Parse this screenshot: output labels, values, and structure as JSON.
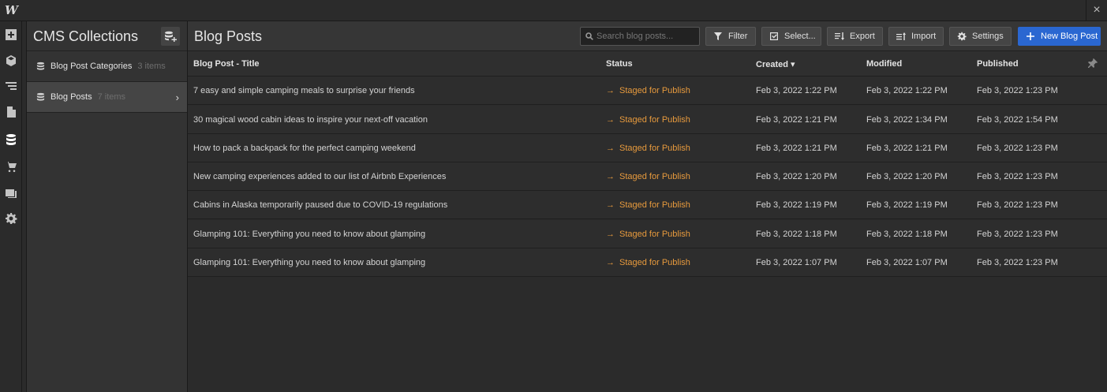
{
  "app": {
    "logo": "W",
    "close": "×"
  },
  "collections": {
    "title": "CMS Collections",
    "items": [
      {
        "name": "Blog Post Categories",
        "count": "3 items"
      },
      {
        "name": "Blog Posts",
        "count": "7 items"
      }
    ]
  },
  "main": {
    "title": "Blog Posts",
    "search_placeholder": "Search blog posts...",
    "buttons": {
      "filter": "Filter",
      "select": "Select...",
      "export": "Export",
      "import": "Import",
      "settings": "Settings",
      "new": "New Blog Post"
    }
  },
  "table": {
    "headers": {
      "title": "Blog Post - Title",
      "status": "Status",
      "created": "Created",
      "modified": "Modified",
      "published": "Published"
    },
    "sort_indicator": "▾",
    "rows": [
      {
        "title": "7 easy and simple camping meals to surprise your friends",
        "status": "Staged for Publish",
        "created": "Feb 3, 2022 1:22 PM",
        "modified": "Feb 3, 2022 1:22 PM",
        "published": "Feb 3, 2022 1:23 PM"
      },
      {
        "title": "30 magical wood cabin ideas to inspire your next-off vacation",
        "status": "Staged for Publish",
        "created": "Feb 3, 2022 1:21 PM",
        "modified": "Feb 3, 2022 1:34 PM",
        "published": "Feb 3, 2022 1:54 PM"
      },
      {
        "title": "How to pack a backpack for the perfect camping weekend",
        "status": "Staged for Publish",
        "created": "Feb 3, 2022 1:21 PM",
        "modified": "Feb 3, 2022 1:21 PM",
        "published": "Feb 3, 2022 1:23 PM"
      },
      {
        "title": "New camping experiences added to our list of Airbnb Experiences",
        "status": "Staged for Publish",
        "created": "Feb 3, 2022 1:20 PM",
        "modified": "Feb 3, 2022 1:20 PM",
        "published": "Feb 3, 2022 1:23 PM"
      },
      {
        "title": "Cabins in Alaska temporarily paused due to COVID-19 regulations",
        "status": "Staged for Publish",
        "created": "Feb 3, 2022 1:19 PM",
        "modified": "Feb 3, 2022 1:19 PM",
        "published": "Feb 3, 2022 1:23 PM"
      },
      {
        "title": "Glamping 101: Everything you need to know about glamping",
        "status": "Staged for Publish",
        "created": "Feb 3, 2022 1:18 PM",
        "modified": "Feb 3, 2022 1:18 PM",
        "published": "Feb 3, 2022 1:23 PM"
      },
      {
        "title": "Glamping 101: Everything you need to know about glamping",
        "status": "Staged for Publish",
        "created": "Feb 3, 2022 1:07 PM",
        "modified": "Feb 3, 2022 1:07 PM",
        "published": "Feb 3, 2022 1:23 PM"
      }
    ]
  },
  "colors": {
    "accent": "#2a67d1",
    "status": "#e79a3d"
  }
}
